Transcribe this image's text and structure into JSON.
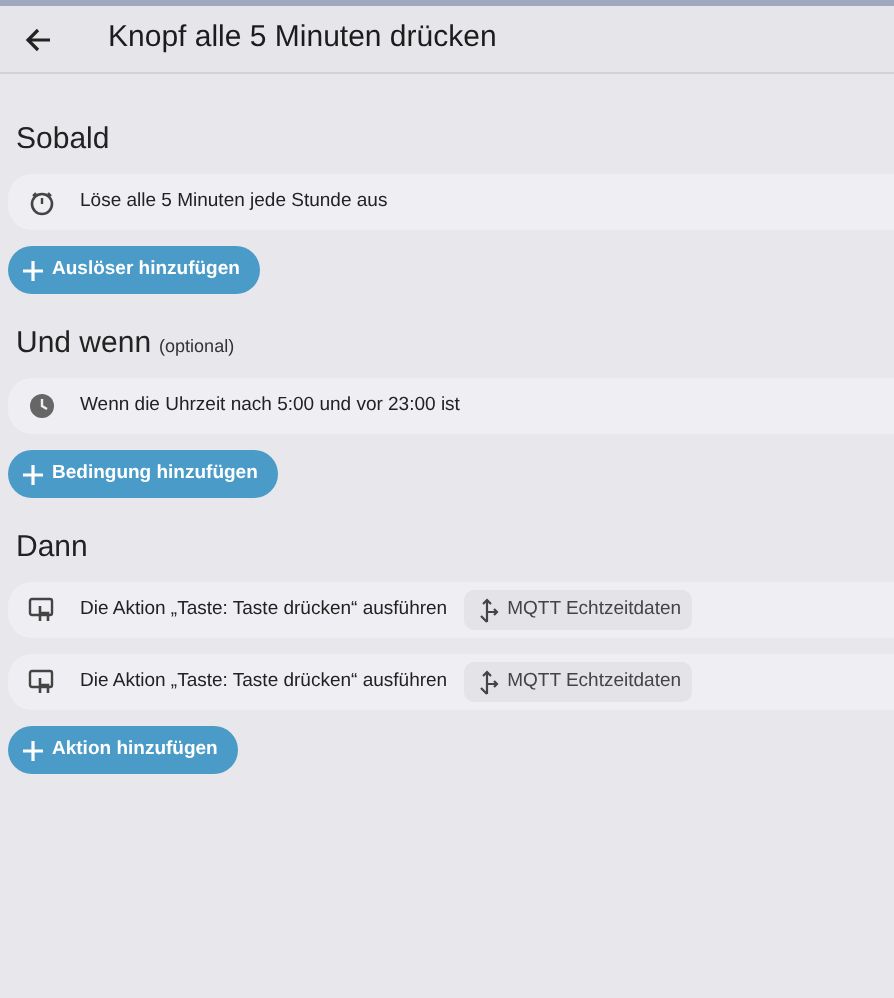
{
  "header": {
    "title": "Knopf alle 5 Minuten drücken"
  },
  "sections": [
    {
      "title": "Sobald",
      "items": [
        {
          "kind": "timer",
          "text": "Löse alle 5 Minuten jede Stunde aus"
        }
      ],
      "add_button": "Auslöser hinzufügen"
    },
    {
      "title": "Und wenn",
      "note": "(optional)",
      "items": [
        {
          "kind": "clock",
          "text": "Wenn die Uhrzeit nach 5:00 und vor 23:00 ist"
        }
      ],
      "add_button": "Bedingung hinzufügen"
    },
    {
      "title": "Dann",
      "items": [
        {
          "kind": "device",
          "text": "Die Aktion „Taste: Taste drücken“ ausführen",
          "chip": "MQTT Echtzeitdaten"
        },
        {
          "kind": "device",
          "text": "Die Aktion „Taste: Taste drücken“ ausführen",
          "chip": "MQTT Echtzeitdaten"
        }
      ],
      "add_button": "Aktion hinzufügen"
    }
  ]
}
